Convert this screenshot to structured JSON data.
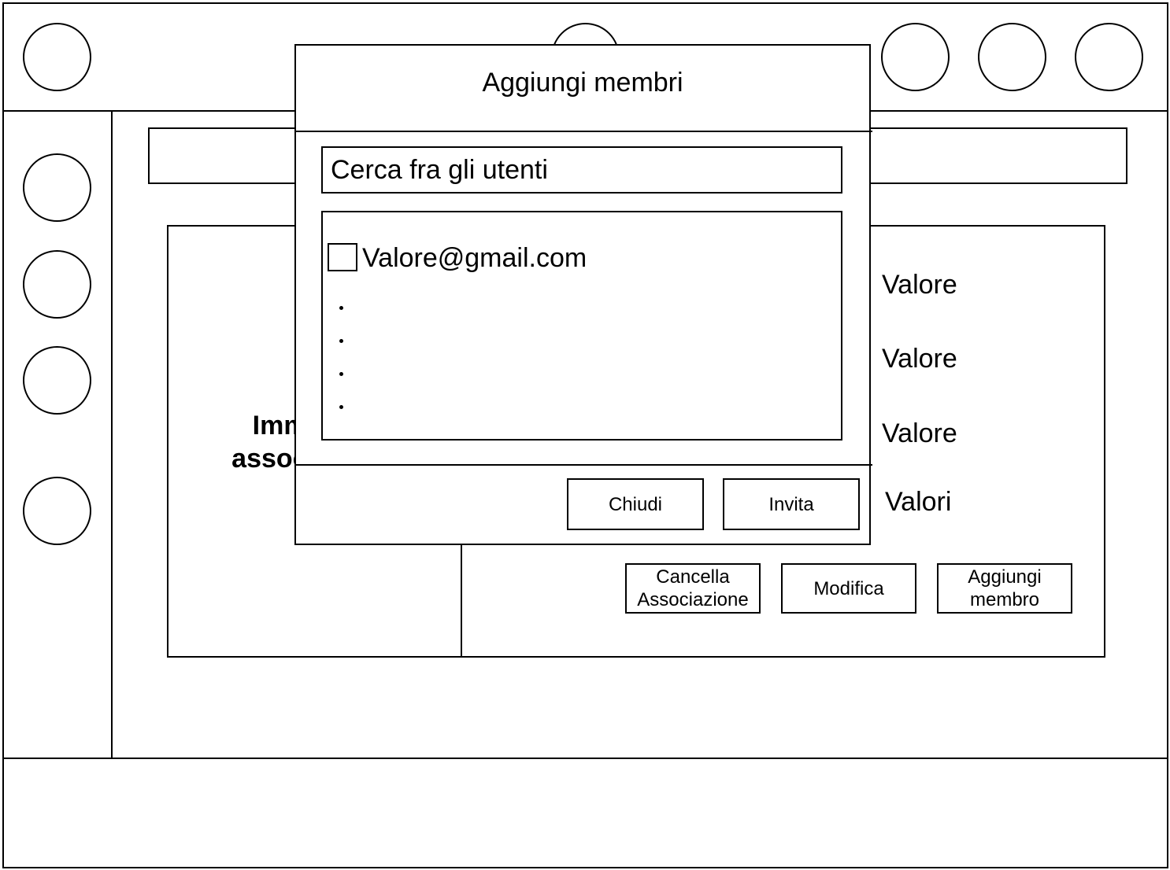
{
  "sidebar": {
    "icons": [
      "circle-icon",
      "circle-icon",
      "circle-icon",
      "circle-icon"
    ]
  },
  "header": {
    "icons": [
      "circle-icon",
      "circle-icon",
      "circle-icon",
      "circle-icon",
      "circle-icon"
    ]
  },
  "association": {
    "image_label_line1": "Immagine",
    "image_label_line2": "associazione",
    "values": [
      "Valore",
      "Valore",
      "Valore",
      "Valori"
    ],
    "buttons": {
      "delete": "Cancella Associazione",
      "edit": "Modifica",
      "add_member": "Aggiungi membro"
    }
  },
  "modal": {
    "title": "Aggiungi membri",
    "search_placeholder": "Cerca fra gli utenti",
    "results": [
      {
        "email": "Valore@gmail.com",
        "checked": false
      }
    ],
    "buttons": {
      "close": "Chiudi",
      "invite": "Invita"
    }
  }
}
